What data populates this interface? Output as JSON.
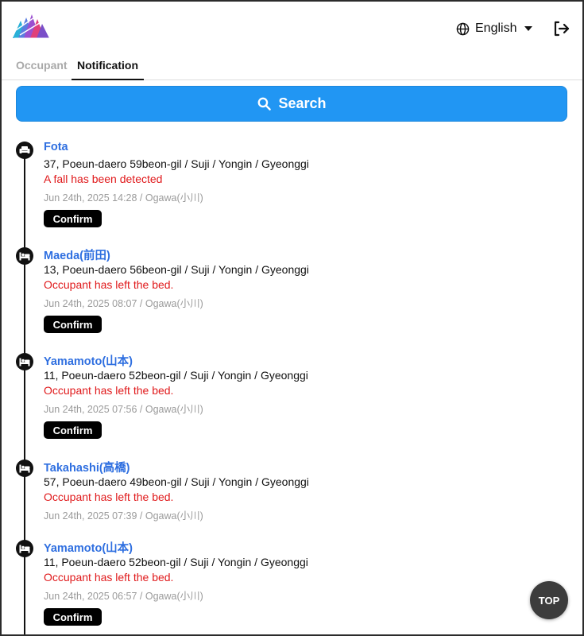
{
  "header": {
    "language": "English",
    "icons": {
      "logo": "brand-logo",
      "globe": "globe-icon",
      "caret": "caret-down-icon",
      "logout": "logout-icon"
    }
  },
  "tabs": [
    {
      "label": "Occupant",
      "active": false
    },
    {
      "label": "Notification",
      "active": true
    }
  ],
  "search": {
    "label": "Search",
    "icon": "search-icon"
  },
  "notifications": [
    {
      "icon": "sofa-icon",
      "name": "Fota",
      "address": "37, Poeun-daero 59beon-gil / Suji / Yongin / Gyeonggi",
      "alert": "A fall has been detected",
      "meta": "Jun 24th, 2025 14:28 / Ogawa(小川)",
      "confirm": "Confirm"
    },
    {
      "icon": "bed-icon",
      "name": "Maeda(前田)",
      "address": "13, Poeun-daero 56beon-gil / Suji / Yongin / Gyeonggi",
      "alert": "Occupant has left the bed.",
      "meta": "Jun 24th, 2025 08:07 / Ogawa(小川)",
      "confirm": "Confirm"
    },
    {
      "icon": "bed-icon",
      "name": "Yamamoto(山本)",
      "address": "11, Poeun-daero 52beon-gil / Suji / Yongin / Gyeonggi",
      "alert": "Occupant has left the bed.",
      "meta": "Jun 24th, 2025 07:56 / Ogawa(小川)",
      "confirm": "Confirm"
    },
    {
      "icon": "bed-icon",
      "name": "Takahashi(高橋)",
      "address": "57, Poeun-daero 49beon-gil / Suji / Yongin / Gyeonggi",
      "alert": "Occupant has left the bed.",
      "meta": "Jun 24th, 2025 07:39 / Ogawa(小川)",
      "confirm": null
    },
    {
      "icon": "bed-icon",
      "name": "Yamamoto(山本)",
      "address": "11, Poeun-daero 52beon-gil / Suji / Yongin / Gyeonggi",
      "alert": "Occupant has left the bed.",
      "meta": "Jun 24th, 2025 06:57 / Ogawa(小川)",
      "confirm": "Confirm"
    }
  ],
  "top_button": "TOP",
  "colors": {
    "accent": "#2196f3",
    "link": "#2f6fe0",
    "alert": "#e0191b",
    "meta": "#9a9a9a"
  }
}
